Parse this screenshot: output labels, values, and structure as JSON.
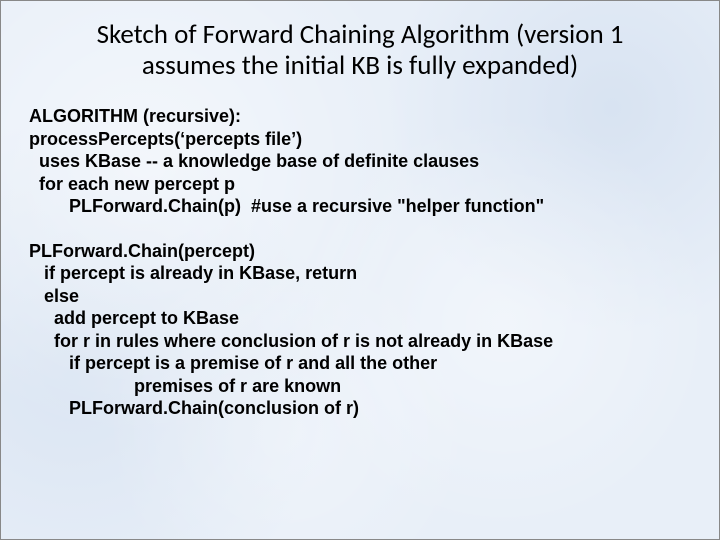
{
  "title_line1": "Sketch of Forward Chaining Algorithm (version 1",
  "title_line2": "assumes the initial KB is fully expanded)",
  "block1": {
    "l1": "ALGORITHM (recursive):",
    "l2": "processPercepts(‘percepts file’)",
    "l3": "  uses KBase -- a knowledge base of definite clauses",
    "l4": "  for each new percept p",
    "l5": "        PLForward.Chain(p)  #use a recursive \"helper function\""
  },
  "block2": {
    "l1": "PLForward.Chain(percept)",
    "l2": "   if percept is already in KBase, return",
    "l3": "   else",
    "l4": "     add percept to KBase",
    "l5": "     for r in rules where conclusion of r is not already in KBase",
    "l6": "        if percept is a premise of r and all the other",
    "l7": "                     premises of r are known",
    "l8": "        PLForward.Chain(conclusion of r)"
  }
}
